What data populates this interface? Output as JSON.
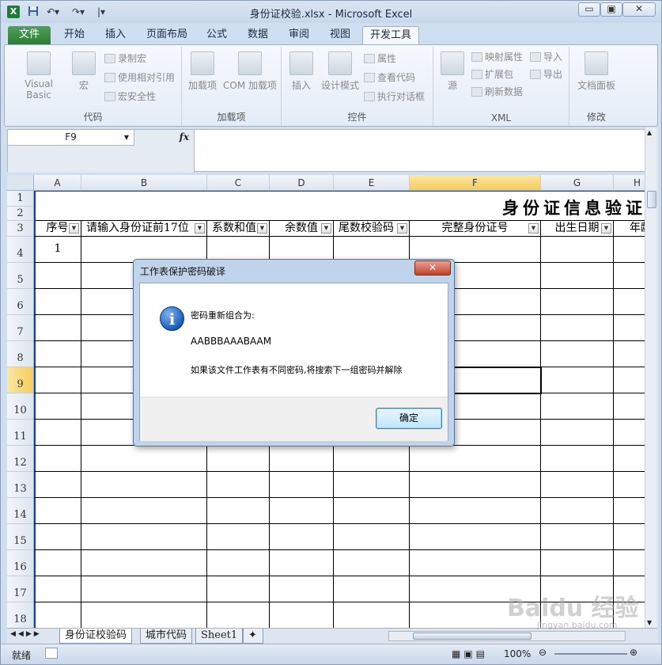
{
  "window": {
    "title": "身份证校验.xlsx - Microsoft Excel",
    "app_icon": "X",
    "quick_access": [
      "save-icon",
      "undo-icon",
      "redo-icon",
      "customize-icon"
    ],
    "controls": {
      "minimize": "▭",
      "restore": "▣",
      "close": "✕"
    }
  },
  "ribbon_tabs": [
    "文件",
    "开始",
    "插入",
    "页面布局",
    "公式",
    "数据",
    "审阅",
    "视图",
    "开发工具"
  ],
  "active_tab": "开发工具",
  "ribbon": {
    "code": {
      "label": "代码",
      "visual_basic": "Visual Basic",
      "macro": "宏",
      "record_macro": "录制宏",
      "relative_ref": "使用相对引用",
      "macro_security": "宏安全性"
    },
    "addins": {
      "label": "加载项",
      "addins": "加载项",
      "com_addins": "COM 加载项"
    },
    "controls": {
      "label": "控件",
      "insert": "插入",
      "design_mode": "设计模式",
      "properties": "属性",
      "view_code": "查看代码",
      "run_dialog": "执行对话框"
    },
    "xml": {
      "label": "XML",
      "source": "源",
      "map_props": "映射属性",
      "expansion_packs": "扩展包",
      "refresh_data": "刷新数据",
      "import": "导入",
      "export": "导出"
    },
    "modify": {
      "label": "修改",
      "doc_panel": "文档面板"
    }
  },
  "name_box": "F9",
  "fx_label": "fx",
  "columns": [
    "A",
    "B",
    "C",
    "D",
    "E",
    "F",
    "G",
    "H"
  ],
  "selected_column": "F",
  "rows": [
    "1",
    "2",
    "3",
    "4",
    "5",
    "6",
    "7",
    "8",
    "9",
    "10",
    "11",
    "12",
    "13",
    "14",
    "15",
    "16",
    "17",
    "18"
  ],
  "selected_row": "9",
  "sheet": {
    "big_title": "身份证信息验证",
    "headers": [
      "序号",
      "请输入身份证前17位",
      "系数和值",
      "余数值",
      "尾数校验码",
      "完整身份证号",
      "出生日期",
      "年龄"
    ],
    "a4": "1"
  },
  "sheet_tabs": [
    "身份证校验码",
    "城市代码",
    "Sheet1"
  ],
  "status": {
    "ready": "就绪",
    "zoom": "100%"
  },
  "dialog": {
    "title": "工作表保护密码破译",
    "close": "✕",
    "line1": "密码重新组合为:",
    "line2": "AABBBAAABAAM",
    "line3": "如果该文件工作表有不同密码,将搜索下一组密码并解除",
    "ok": "确定"
  },
  "watermark": {
    "brand": "Baidu 经验",
    "url": "jingyan.baidu.com"
  }
}
